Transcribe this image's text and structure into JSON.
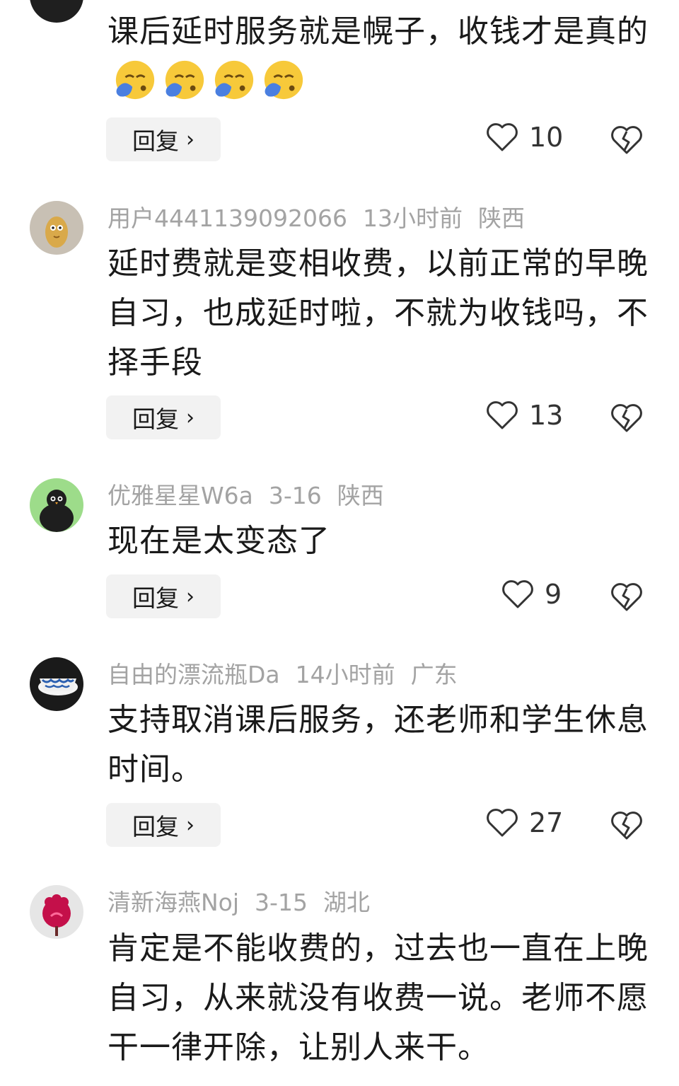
{
  "comments": [
    {
      "user": "",
      "time": "",
      "location": "",
      "text": "课后延时服务就是幌子，收钱才是真的",
      "emoji": "crying-face-emoji",
      "emoji_count": 4,
      "reply_label": "回复",
      "likes": "10"
    },
    {
      "user": "用户4441139092066",
      "time": "13小时前",
      "location": "陕西",
      "text": "延时费就是变相收费，以前正常的早晚自习，也成延时啦，不就为收钱吗，不择手段",
      "reply_label": "回复",
      "likes": "13"
    },
    {
      "user": "优雅星星W6a",
      "time": "3-16",
      "location": "陕西",
      "text": "现在是太变态了",
      "reply_label": "回复",
      "likes": "9"
    },
    {
      "user": "自由的漂流瓶Da",
      "time": "14小时前",
      "location": "广东",
      "text": "支持取消课后服务，还老师和学生休息时间。",
      "reply_label": "回复",
      "likes": "27"
    },
    {
      "user": "清新海燕Noj",
      "time": "3-15",
      "location": "湖北",
      "text": "肯定是不能收费的，过去也一直在上晚自习，从来就没有收费一说。老师不愿干一律开除，让别人来干。"
    }
  ],
  "icons": {
    "like": "heart-outline-icon",
    "dislike": "broken-heart-icon",
    "reply_chevron": "chevron-right-icon"
  },
  "colors": {
    "text": "#1a1a1a",
    "meta": "#a3a3a3",
    "reply_bg": "#f2f2f2"
  }
}
